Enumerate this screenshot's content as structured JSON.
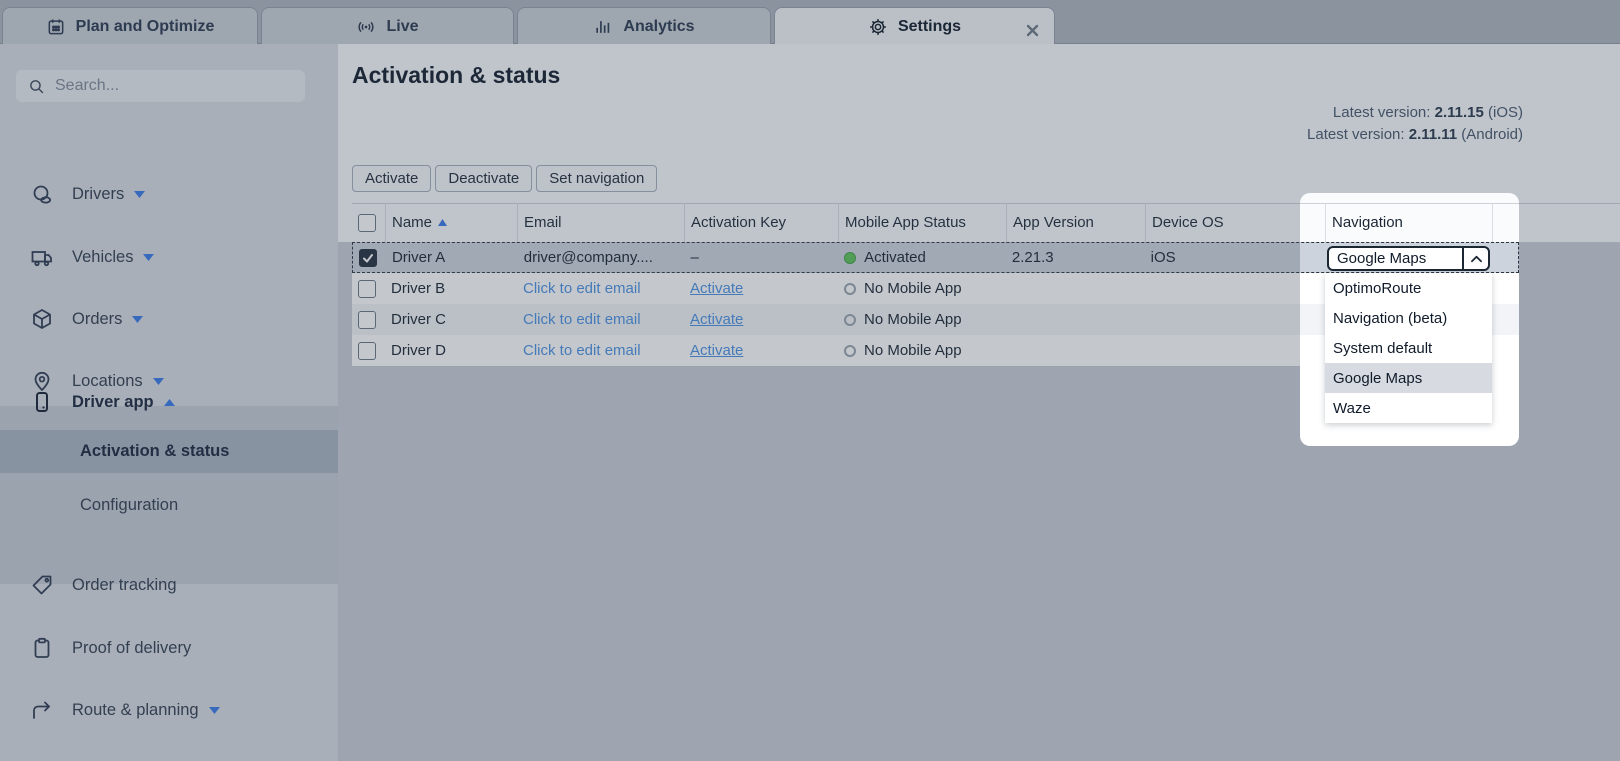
{
  "tabs": [
    {
      "label": "Plan and Optimize"
    },
    {
      "label": "Live"
    },
    {
      "label": "Analytics"
    },
    {
      "label": "Settings"
    }
  ],
  "sidebar": {
    "search_placeholder": "Search...",
    "drivers_label": "Drivers",
    "vehicles_label": "Vehicles",
    "orders_label": "Orders",
    "locations_label": "Locations",
    "driver_app_label": "Driver app",
    "activation_label": "Activation & status",
    "configuration_label": "Configuration",
    "order_tracking_label": "Order tracking",
    "proof_label": "Proof of delivery",
    "route_label": "Route & planning"
  },
  "main": {
    "title": "Activation & status",
    "version_ios": {
      "prefix": "Latest version: ",
      "value": "2.11.15",
      "suffix": " (iOS)"
    },
    "version_android": {
      "prefix": "Latest version: ",
      "value": "2.11.11",
      "suffix": " (Android)"
    },
    "buttons": {
      "activate": "Activate",
      "deactivate": "Deactivate",
      "set_navigation": "Set navigation"
    }
  },
  "table": {
    "headers": {
      "name": "Name",
      "email": "Email",
      "activation_key": "Activation Key",
      "mobile_app_status": "Mobile App Status",
      "app_version": "App Version",
      "device_os": "Device OS",
      "navigation": "Navigation"
    },
    "rows": [
      {
        "name": "Driver A",
        "email": "driver@company....",
        "activation_key": "–",
        "status": "Activated",
        "app_version": "2.21.3",
        "device_os": "iOS"
      },
      {
        "name": "Driver B",
        "email": "Click to edit email",
        "activation_key": "Activate",
        "status": "No Mobile App"
      },
      {
        "name": "Driver C",
        "email": "Click to edit email",
        "activation_key": "Activate",
        "status": "No Mobile App"
      },
      {
        "name": "Driver D",
        "email": "Click to edit email",
        "activation_key": "Activate",
        "status": "No Mobile App"
      }
    ]
  },
  "dropdown": {
    "value": "Google Maps",
    "options": [
      "OptimoRoute",
      "Navigation (beta)",
      "System default",
      "Google Maps",
      "Waze"
    ],
    "selected_value": "Google Maps"
  },
  "colors": {
    "accent_blue": "#3579e8",
    "link_blue": "#4a90e2",
    "activated_green": "#5dc356",
    "selected_row": "#ccd3dc",
    "overlay": "rgba(61,74,89,0.30)"
  }
}
